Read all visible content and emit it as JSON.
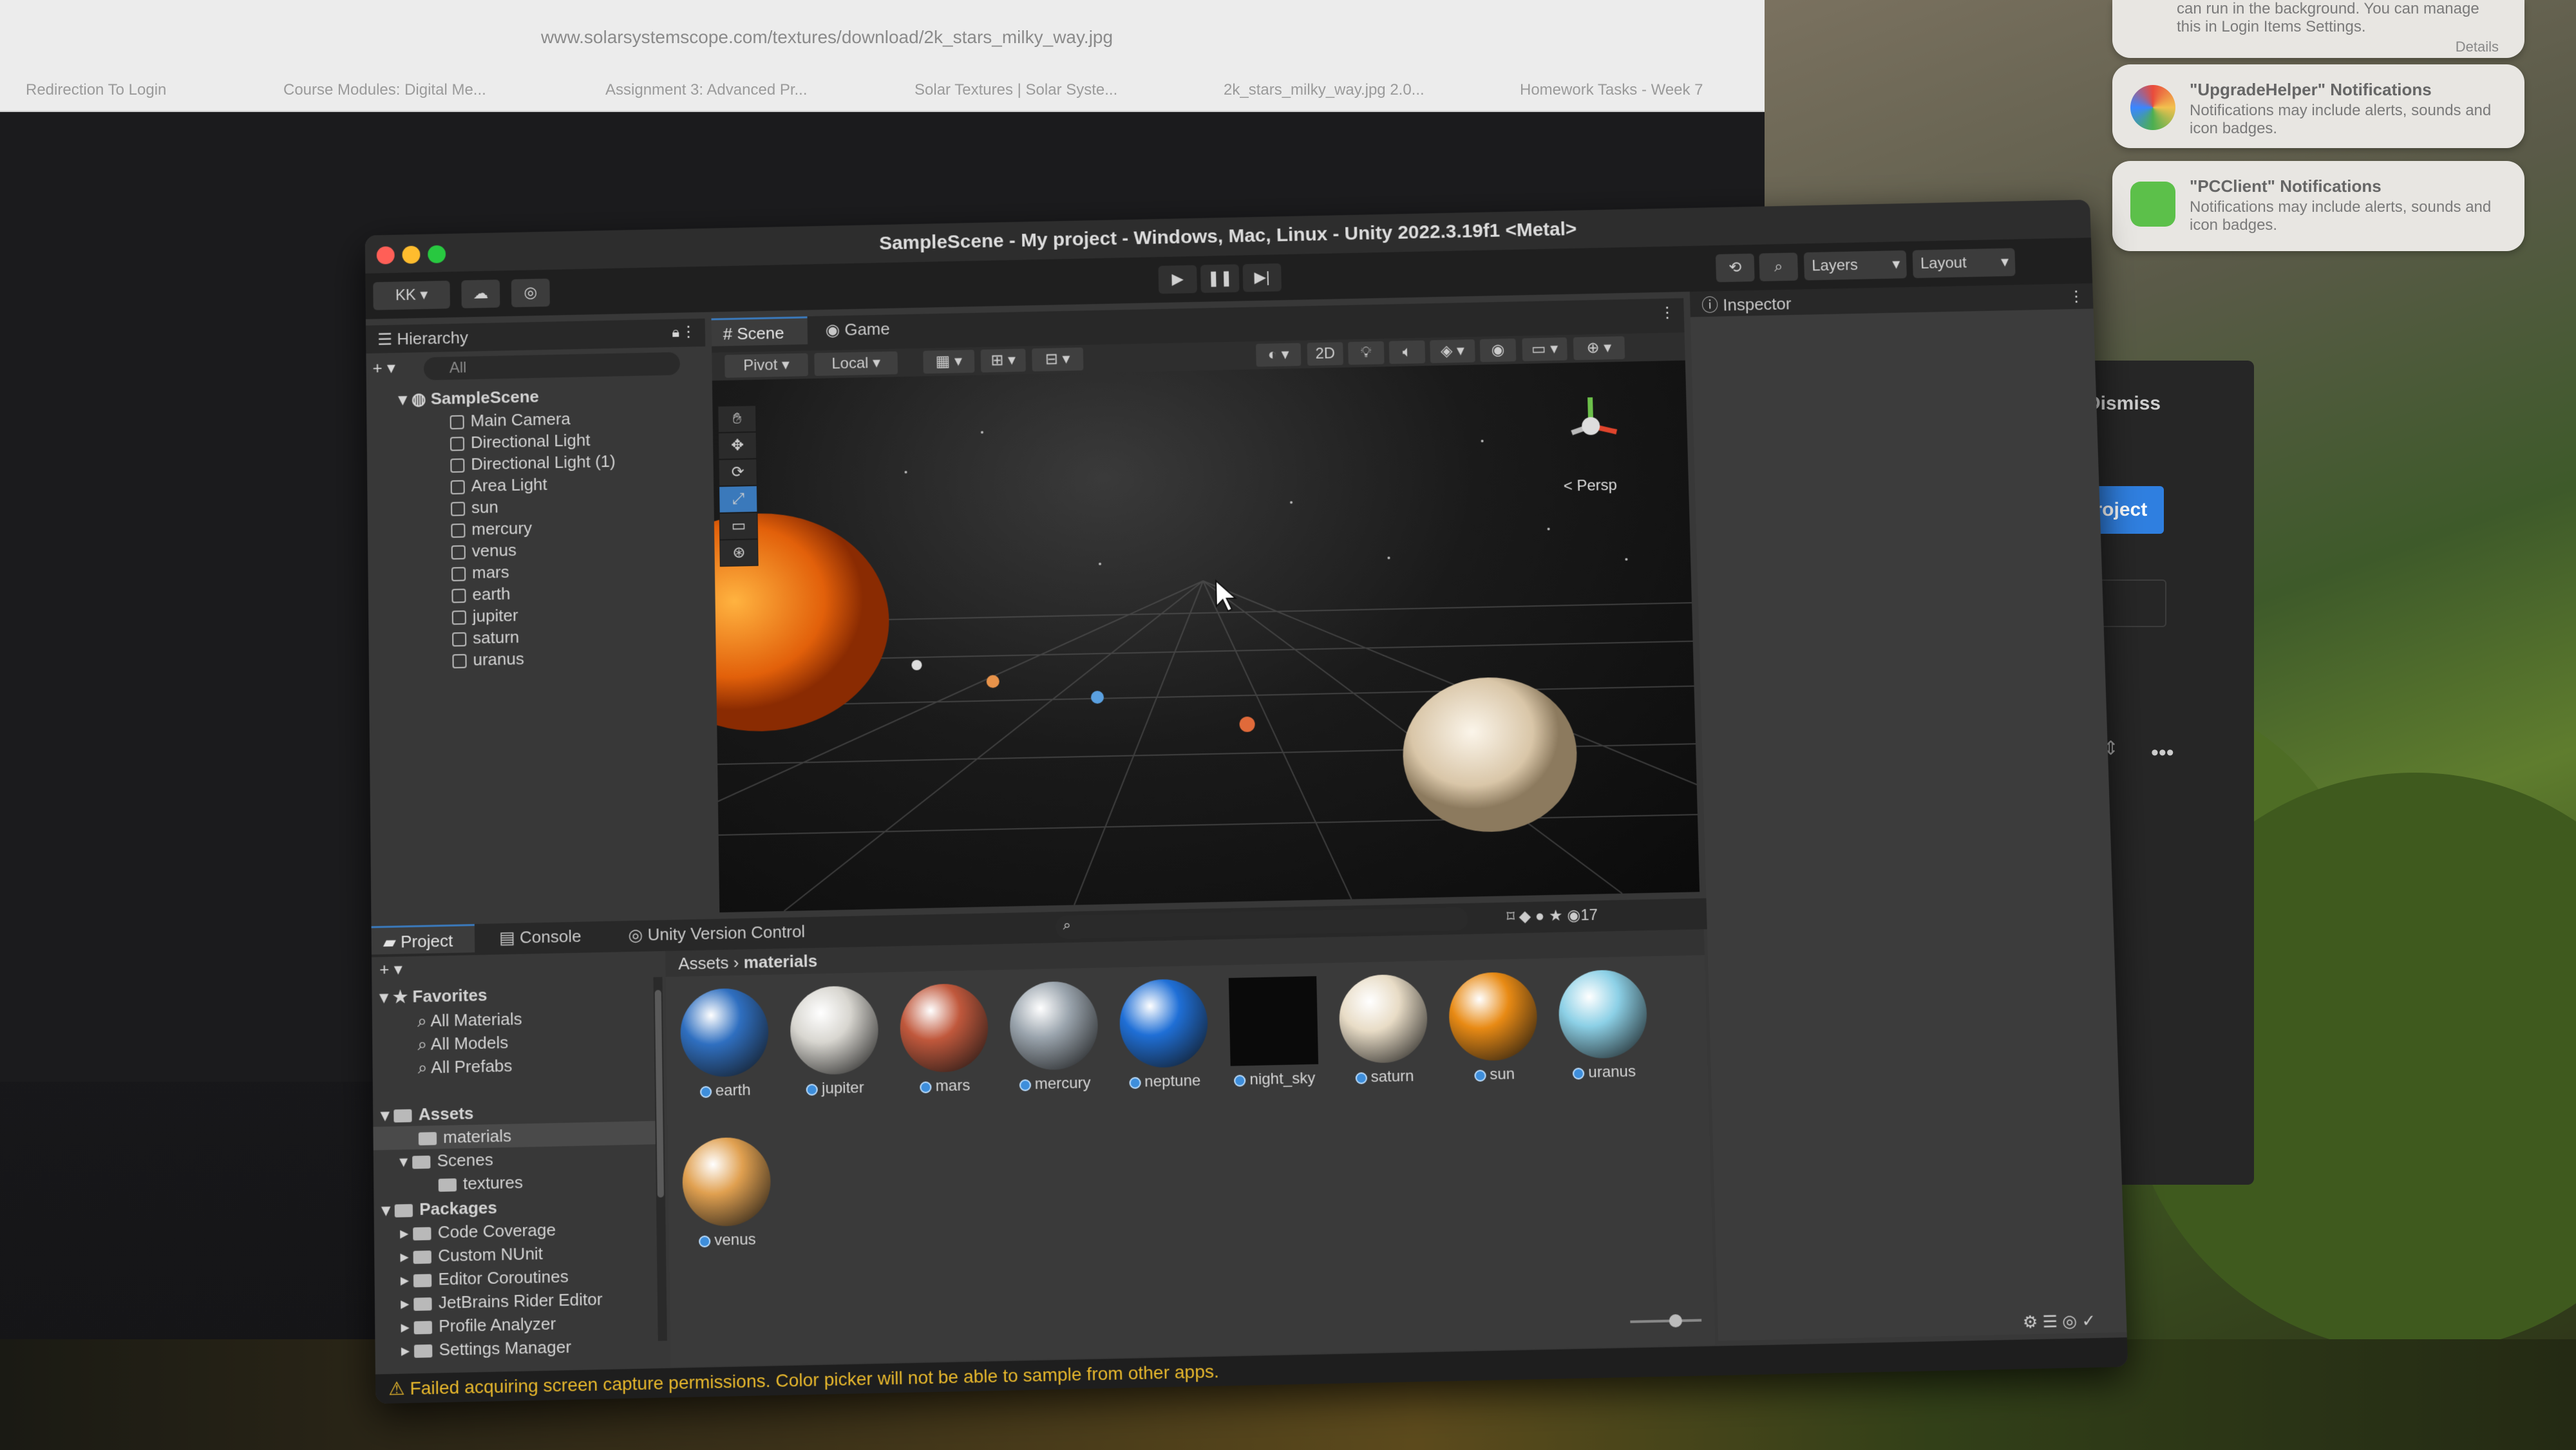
{
  "browser": {
    "url": "www.solarsystemscope.com/textures/download/2k_stars_milky_way.jpg",
    "tabs": [
      "Redirection To Login",
      "Course Modules: Digital Me...",
      "Assignment 3: Advanced Pr...",
      "Solar Textures | Solar Syste...",
      "2k_stars_milky_way.jpg 2.0...",
      "Homework Tasks - Week 7"
    ]
  },
  "notifications": [
    {
      "title": "",
      "body": "can run in the background. You can manage this in Login Items Settings.",
      "link": "Details"
    },
    {
      "title": "\"UpgradeHelper\" Notifications",
      "body": "Notifications may include alerts, sounds and icon badges."
    },
    {
      "title": "\"PCClient\" Notifications",
      "body": "Notifications may include alerts, sounds and icon badges."
    }
  ],
  "hub": {
    "dismiss": "Dismiss",
    "new_project": "ew project",
    "dots": "•••"
  },
  "window": {
    "title": "SampleScene - My project - Windows, Mac, Linux - Unity 2022.3.19f1 <Metal>",
    "account": "KK",
    "layers_label": "Layers",
    "layout_label": "Layout"
  },
  "hierarchy": {
    "tab": "Hierarchy",
    "search_placeholder": "All",
    "scene": "SampleScene",
    "items": [
      "Main Camera",
      "Directional Light",
      "Directional Light (1)",
      "Area Light",
      "sun",
      "mercury",
      "venus",
      "mars",
      "earth",
      "jupiter",
      "saturn",
      "uranus"
    ]
  },
  "scene": {
    "tabs": [
      "Scene",
      "Game"
    ],
    "pivot": "Pivot",
    "local": "Local",
    "mode_2d": "2D",
    "persp": "< Persp"
  },
  "inspector": {
    "tab": "Inspector"
  },
  "project": {
    "tabs": [
      "Project",
      "Console",
      "Unity Version Control"
    ],
    "favorites_label": "Favorites",
    "favorites": [
      "All Materials",
      "All Models",
      "All Prefabs"
    ],
    "assets_label": "Assets",
    "assets_children": [
      "materials",
      "Scenes",
      "textures"
    ],
    "packages_label": "Packages",
    "packages": [
      "Code Coverage",
      "Custom NUnit",
      "Editor Coroutines",
      "JetBrains Rider Editor",
      "Profile Analyzer",
      "Settings Manager"
    ],
    "breadcrumb": [
      "Assets",
      "materials"
    ],
    "hidden_count": "17",
    "materials": [
      {
        "name": "earth",
        "color": "#2f6fc0"
      },
      {
        "name": "jupiter",
        "color": "#d8d6d0"
      },
      {
        "name": "mars",
        "color": "#c0583c"
      },
      {
        "name": "mercury",
        "color": "#9aa4ad"
      },
      {
        "name": "neptune",
        "color": "#1f6fd6"
      },
      {
        "name": "night_sky",
        "color": "#0a0a0a"
      },
      {
        "name": "saturn",
        "color": "#e8dcc6"
      },
      {
        "name": "sun",
        "color": "#e88a14"
      },
      {
        "name": "uranus",
        "color": "#8cd0e6"
      },
      {
        "name": "venus",
        "color": "#e0a050"
      }
    ]
  },
  "status": "Failed acquiring screen capture permissions. Color picker will not be able to sample from other apps."
}
